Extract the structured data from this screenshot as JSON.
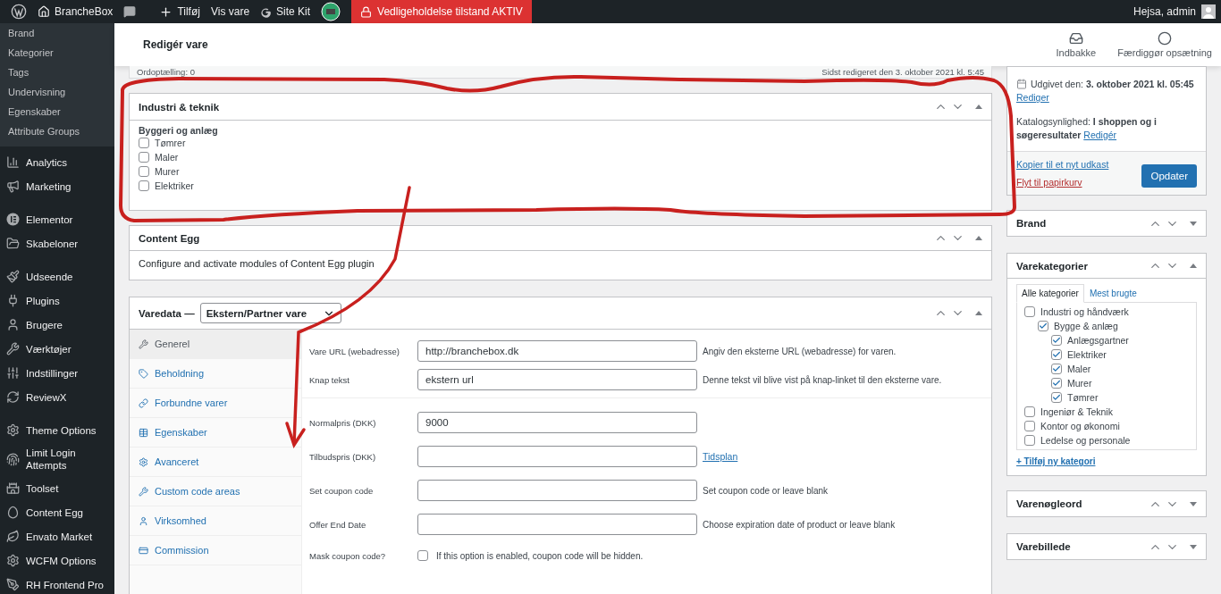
{
  "admin_bar": {
    "site_name": "BrancheBox",
    "new_label": "Tilføj",
    "view_label": "Vis vare",
    "sitekit_label": "Site Kit",
    "maintenance": "Vedligeholdelse tilstand AKTIV",
    "greeting": "Hejsa, admin"
  },
  "sidebar": {
    "submenu": [
      "Brand",
      "Kategorier",
      "Tags",
      "Undervisning",
      "Egenskaber",
      "Attribute Groups"
    ],
    "menu_groups": [
      [
        "Analytics",
        "Marketing"
      ],
      [
        "Elementor",
        "Skabeloner"
      ],
      [
        "Udseende",
        "Plugins",
        "Brugere",
        "Værktøjer",
        "Indstillinger",
        "ReviewX"
      ],
      [
        "Theme Options",
        "Limit Login Attempts",
        "Toolset",
        "Content Egg",
        "Envato Market",
        "WCFM Options",
        "RH Frontend Pro"
      ]
    ]
  },
  "header": {
    "title": "Redigér vare",
    "actions": [
      {
        "label": "Indbakke"
      },
      {
        "label": "Færdiggør opsætning"
      }
    ]
  },
  "editor_footer": {
    "word_count": "Ordoptælling: 0",
    "last_edited": "Sidst redigeret den 3. oktober 2021 kl. 5:45"
  },
  "industry_box": {
    "title": "Industri & teknik",
    "expanded": true,
    "group_label": "Byggeri og anlæg",
    "options": [
      {
        "label": "Tømrer",
        "checked": false
      },
      {
        "label": "Maler",
        "checked": false
      },
      {
        "label": "Murer",
        "checked": false
      },
      {
        "label": "Elektriker",
        "checked": false
      }
    ]
  },
  "content_egg_box": {
    "title": "Content Egg",
    "expanded": true,
    "text": "Configure and activate modules of Content Egg plugin"
  },
  "product_data": {
    "title": "Varedata —",
    "type_select": "Ekstern/Partner vare",
    "expanded": true,
    "tabs": [
      {
        "label": "Generel",
        "selected": true
      },
      {
        "label": "Beholdning",
        "selected": false
      },
      {
        "label": "Forbundne varer",
        "selected": false
      },
      {
        "label": "Egenskaber",
        "selected": false
      },
      {
        "label": "Avanceret",
        "selected": false
      },
      {
        "label": "Custom code areas",
        "selected": false
      },
      {
        "label": "Virksomhed",
        "selected": false
      },
      {
        "label": "Commission",
        "selected": false
      }
    ],
    "field_groups": [
      [
        {
          "kind": "text",
          "label": "Vare URL (webadresse)",
          "value": "http://branchebox.dk",
          "help": "Angiv den eksterne URL (webadresse) for varen."
        },
        {
          "kind": "text",
          "label": "Knap tekst",
          "value": "ekstern url",
          "help": "Denne tekst vil blive vist på knap-linket til den eksterne vare."
        }
      ],
      [
        {
          "kind": "text",
          "label": "Normalpris (DKK)",
          "value": "9000"
        },
        {
          "kind": "text",
          "label": "Tilbudspris (DKK)",
          "link": "Tidsplan"
        },
        {
          "kind": "text",
          "label": "Set coupon code",
          "help": "Set coupon code or leave blank"
        },
        {
          "kind": "text",
          "label": "Offer End Date",
          "help": "Choose expiration date of product or leave blank"
        },
        {
          "kind": "checkbox",
          "label": "Mask coupon code?",
          "checked": false,
          "help": "If this option is enabled, coupon code will be hidden."
        }
      ]
    ]
  },
  "publish": {
    "published_label": "Udgivet den:",
    "published_date": "3. oktober 2021 kl. 05:45",
    "edit_link": "Rediger",
    "visibility_label": "Katalogsynlighed:",
    "visibility_value": "I shoppen og i søgeresultater",
    "visibility_edit": "Redigér",
    "copy_link": "Kopier til et nyt udkast",
    "trash_link": "Flyt til papirkurv",
    "update_button": "Opdater"
  },
  "side_boxes": [
    {
      "kind": "simple",
      "title": "Brand",
      "expanded": false
    },
    {
      "kind": "categories",
      "title": "Varekategorier",
      "expanded": true,
      "tabs": [
        {
          "label": "Alle kategorier",
          "selected": true
        },
        {
          "label": "Mest brugte",
          "selected": false
        }
      ],
      "categories": [
        {
          "label": "Industri og håndværk",
          "checked": false,
          "children": [
            {
              "label": "Bygge & anlæg",
              "checked": true,
              "children": [
                {
                  "label": "Anlægsgartner",
                  "checked": true
                },
                {
                  "label": "Elektriker",
                  "checked": true
                },
                {
                  "label": "Maler",
                  "checked": true
                },
                {
                  "label": "Murer",
                  "checked": true
                },
                {
                  "label": "Tømrer",
                  "checked": true
                }
              ]
            }
          ]
        },
        {
          "label": "Ingeniør & Teknik",
          "checked": false
        },
        {
          "label": "Kontor og økonomi",
          "checked": false
        },
        {
          "label": "Ledelse og personale",
          "checked": false
        }
      ],
      "add_link": "+ Tilføj ny kategori"
    },
    {
      "kind": "simple",
      "title": "Varenøgleord",
      "expanded": false
    },
    {
      "kind": "simple",
      "title": "Varebillede",
      "expanded": false
    }
  ]
}
